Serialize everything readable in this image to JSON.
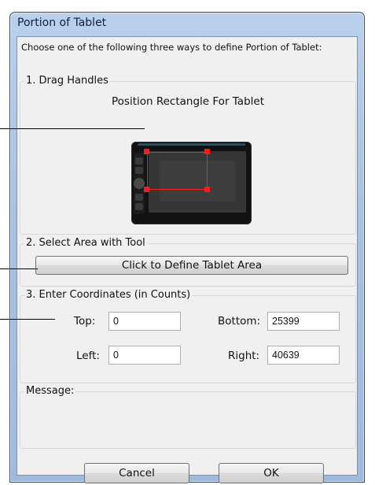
{
  "window": {
    "title": "Portion of Tablet"
  },
  "intro": {
    "text": "Choose one of the following three ways to define Portion of Tablet:"
  },
  "drag_handles": {
    "legend": "1. Drag Handles",
    "caption": "Position Rectangle For Tablet"
  },
  "select_area": {
    "legend": "2. Select Area with Tool",
    "button_label": "Click to Define Tablet Area"
  },
  "coordinates": {
    "legend": "3. Enter Coordinates (in Counts)",
    "top_label": "Top:",
    "top_value": "0",
    "bottom_label": "Bottom:",
    "bottom_value": "25399",
    "left_label": "Left:",
    "left_value": "0",
    "right_label": "Right:",
    "right_value": "40639"
  },
  "message": {
    "legend": "Message:"
  },
  "buttons": {
    "cancel": "Cancel",
    "ok": "OK"
  },
  "colors": {
    "handle": "#ff1a1a",
    "window_frame": "#a7c2e0",
    "client_bg": "#f0f0f0"
  }
}
